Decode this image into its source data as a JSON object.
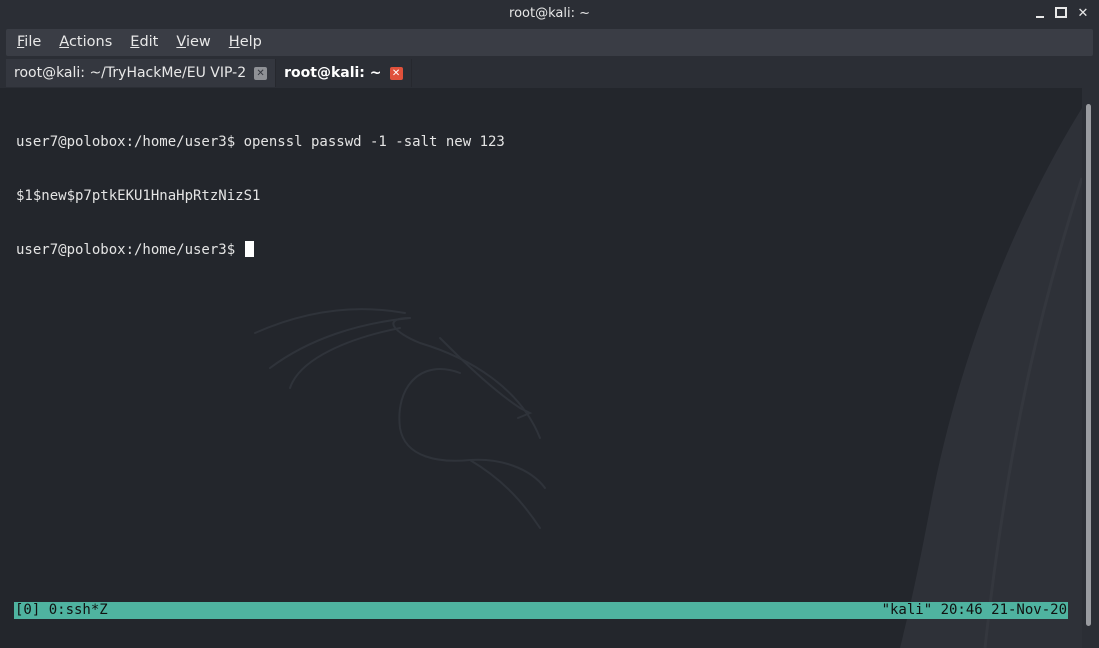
{
  "window": {
    "title": "root@kali: ~",
    "controls": {
      "minimize": "minimize-icon",
      "maximize": "maximize-icon",
      "close": "close-icon"
    }
  },
  "menu": {
    "items": [
      {
        "mnemonic": "F",
        "rest": "ile"
      },
      {
        "mnemonic": "A",
        "rest": "ctions"
      },
      {
        "mnemonic": "E",
        "rest": "dit"
      },
      {
        "mnemonic": "V",
        "rest": "iew"
      },
      {
        "mnemonic": "H",
        "rest": "elp"
      }
    ]
  },
  "tabs": [
    {
      "label": "root@kali: ~/TryHackMe/EU VIP-2",
      "active": false
    },
    {
      "label": "root@kali: ~",
      "active": true
    }
  ],
  "terminal": {
    "lines": [
      "user7@polobox:/home/user3$ openssl passwd -1 -salt new 123",
      "$1$new$p7ptkEKU1HnaHpRtzNizS1",
      "user7@polobox:/home/user3$ "
    ]
  },
  "statusbar": {
    "left": "[0] 0:ssh*Z",
    "right": "\"kali\" 20:46 21-Nov-20"
  },
  "colors": {
    "background": "#23262c",
    "chrome": "#2b2e35",
    "status_bar": "#4fb3a0",
    "active_tab_close": "#e0513b"
  }
}
